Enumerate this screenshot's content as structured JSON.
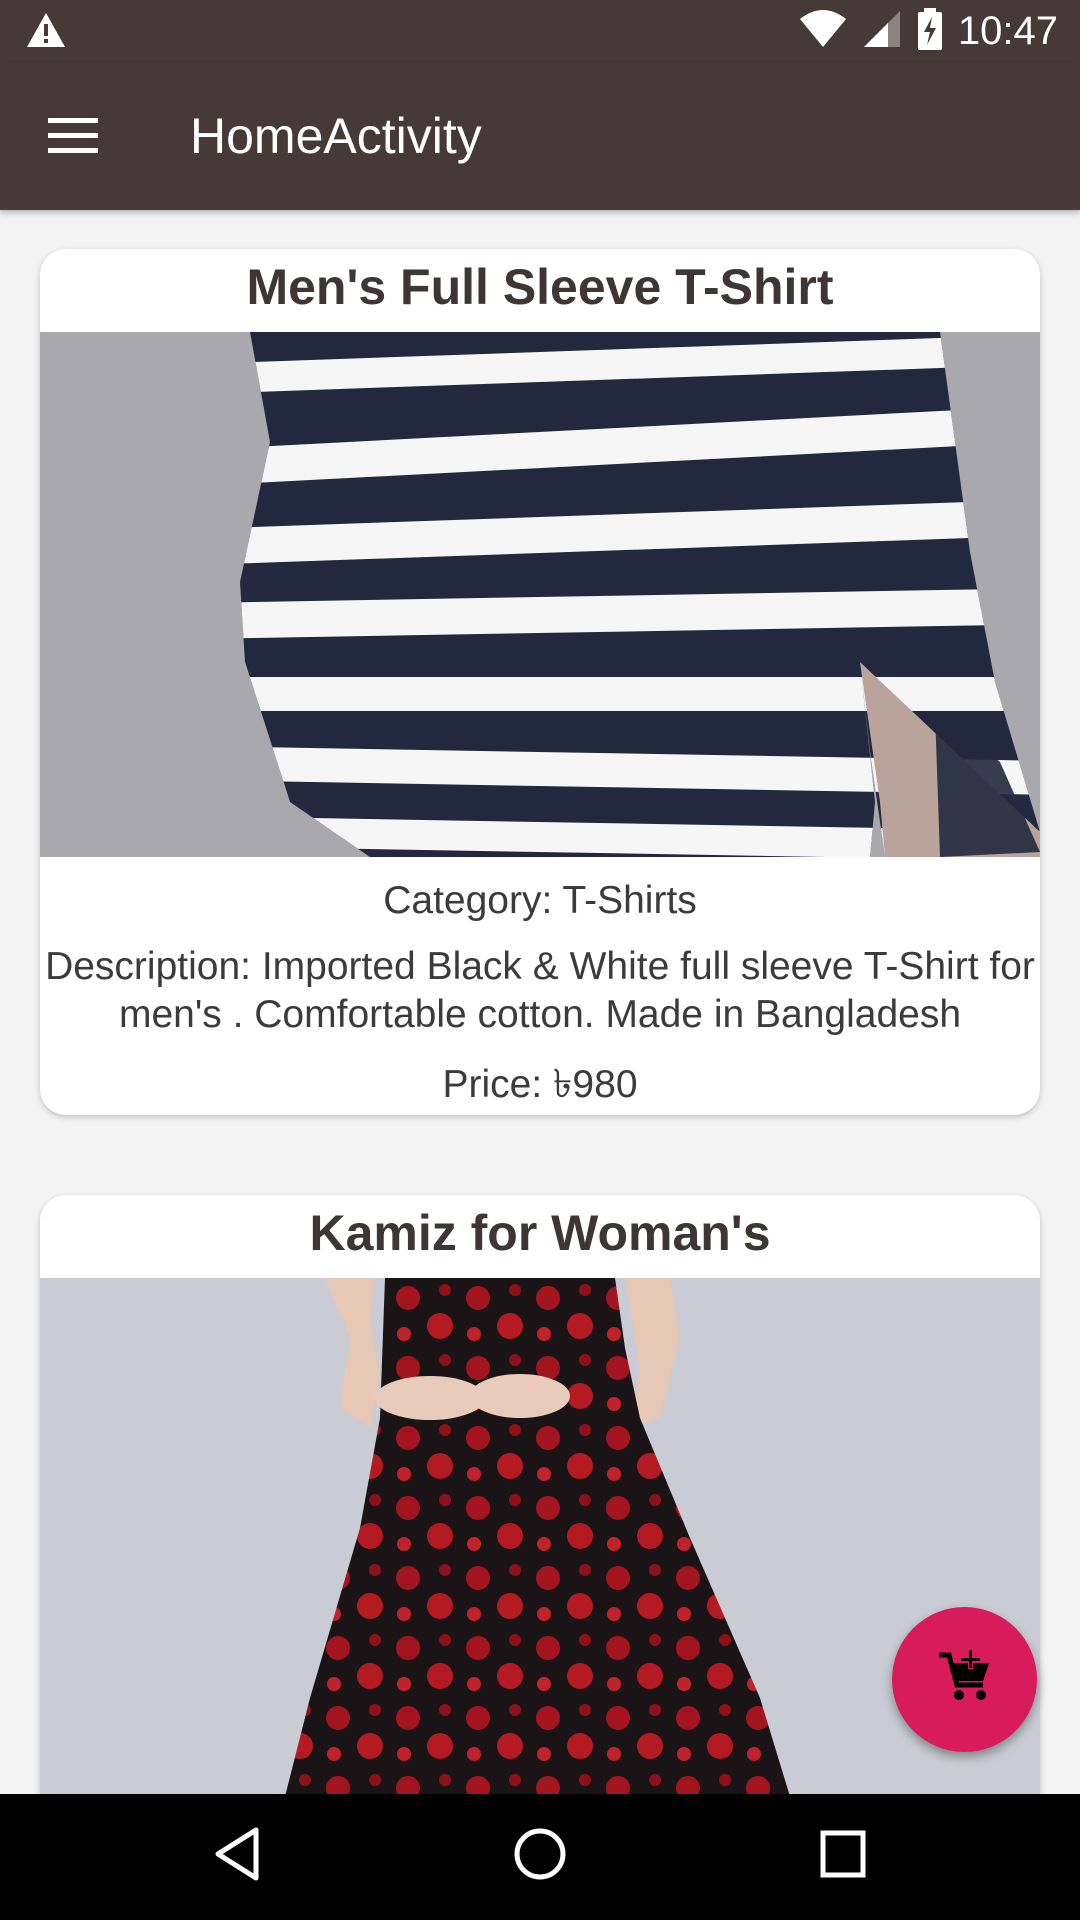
{
  "status_bar": {
    "time": "10:47",
    "icons": [
      "warning-icon",
      "wifi-icon",
      "signal-icon",
      "battery-icon"
    ]
  },
  "app_bar": {
    "title": "HomeActivity",
    "menu_icon": "hamburger-menu-icon"
  },
  "products": [
    {
      "title": "Men's Full Sleeve T-Shirt",
      "image": "striped-tshirt-image",
      "category": "Category: T-Shirts",
      "description": "Description: Imported Black & White full sleeve T-Shirt for men's . Comfortable cotton. Made in Bangladesh",
      "price": "Price: ৳980"
    },
    {
      "title": "Kamiz for Woman's",
      "image": "floral-dress-image"
    }
  ],
  "fab": {
    "icon": "add-to-cart-icon",
    "color": "#d81b5b"
  },
  "nav_bar": {
    "buttons": [
      "back-icon",
      "home-icon",
      "recents-icon"
    ]
  },
  "colors": {
    "app_bar": "#453a35",
    "background": "#f3f3f3"
  }
}
